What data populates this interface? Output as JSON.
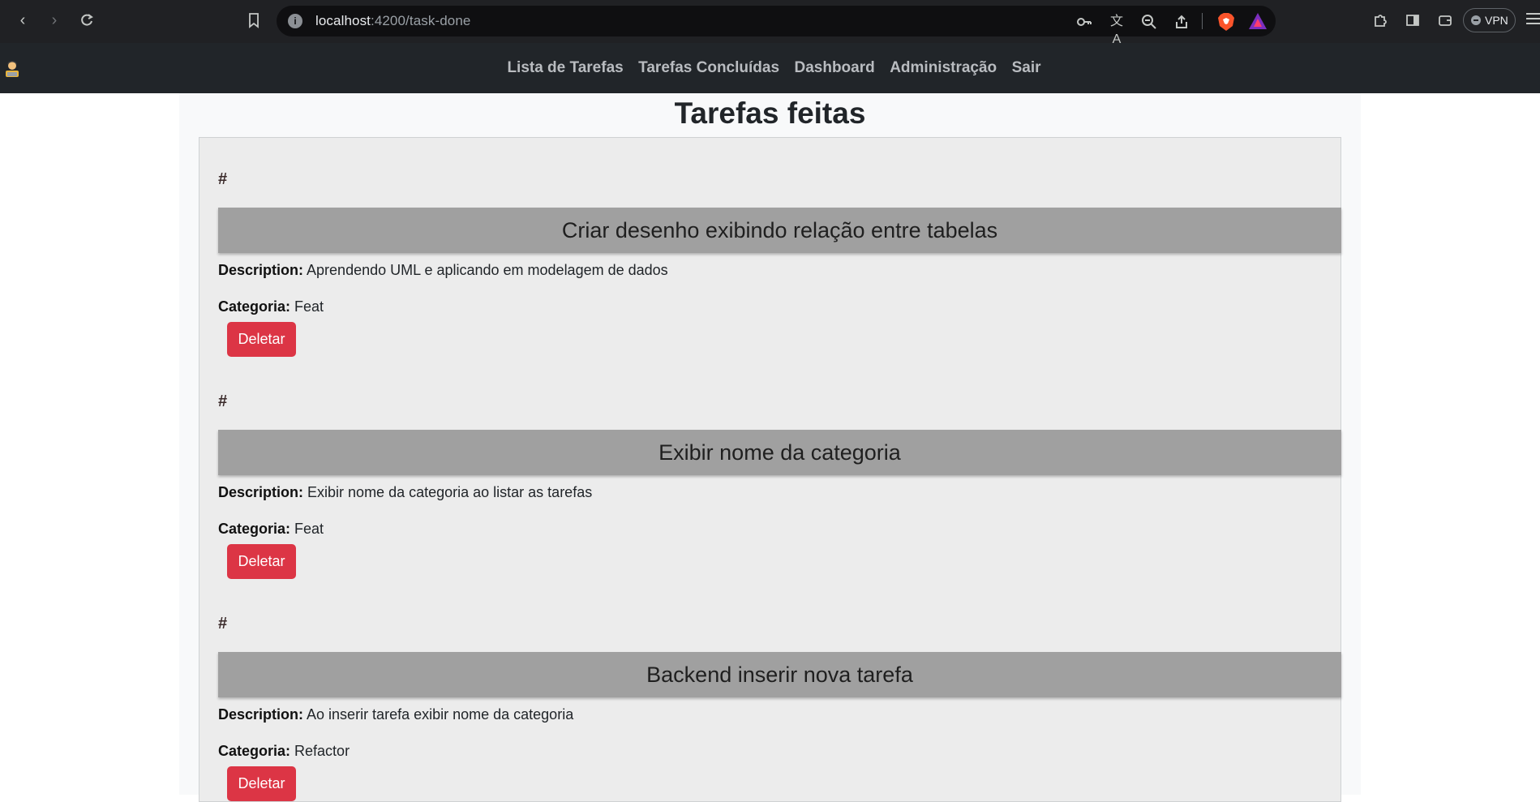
{
  "browser": {
    "url_host": "localhost",
    "url_path": ":4200/task-done",
    "vpn_label": "VPN"
  },
  "navbar": {
    "items": [
      {
        "label": "Lista de Tarefas"
      },
      {
        "label": "Tarefas Concluídas"
      },
      {
        "label": "Dashboard"
      },
      {
        "label": "Administração"
      },
      {
        "label": "Sair"
      }
    ]
  },
  "page": {
    "title": "Tarefas feitas",
    "description_label": "Description:",
    "category_label": "Categoria:",
    "tasks": [
      {
        "id_label": "#",
        "title": "Criar desenho exibindo relação entre tabelas",
        "description": "Aprendendo UML e aplicando em modelagem de dados",
        "category": "Feat",
        "delete_label": "Deletar"
      },
      {
        "id_label": "#",
        "title": "Exibir nome da categoria",
        "description": "Exibir nome da categoria ao listar as tarefas",
        "category": "Feat",
        "delete_label": "Deletar"
      },
      {
        "id_label": "#",
        "title": "Backend inserir nova tarefa",
        "description": "Ao inserir tarefa exibir nome da categoria",
        "category": "Refactor",
        "delete_label": "Deletar"
      }
    ]
  }
}
